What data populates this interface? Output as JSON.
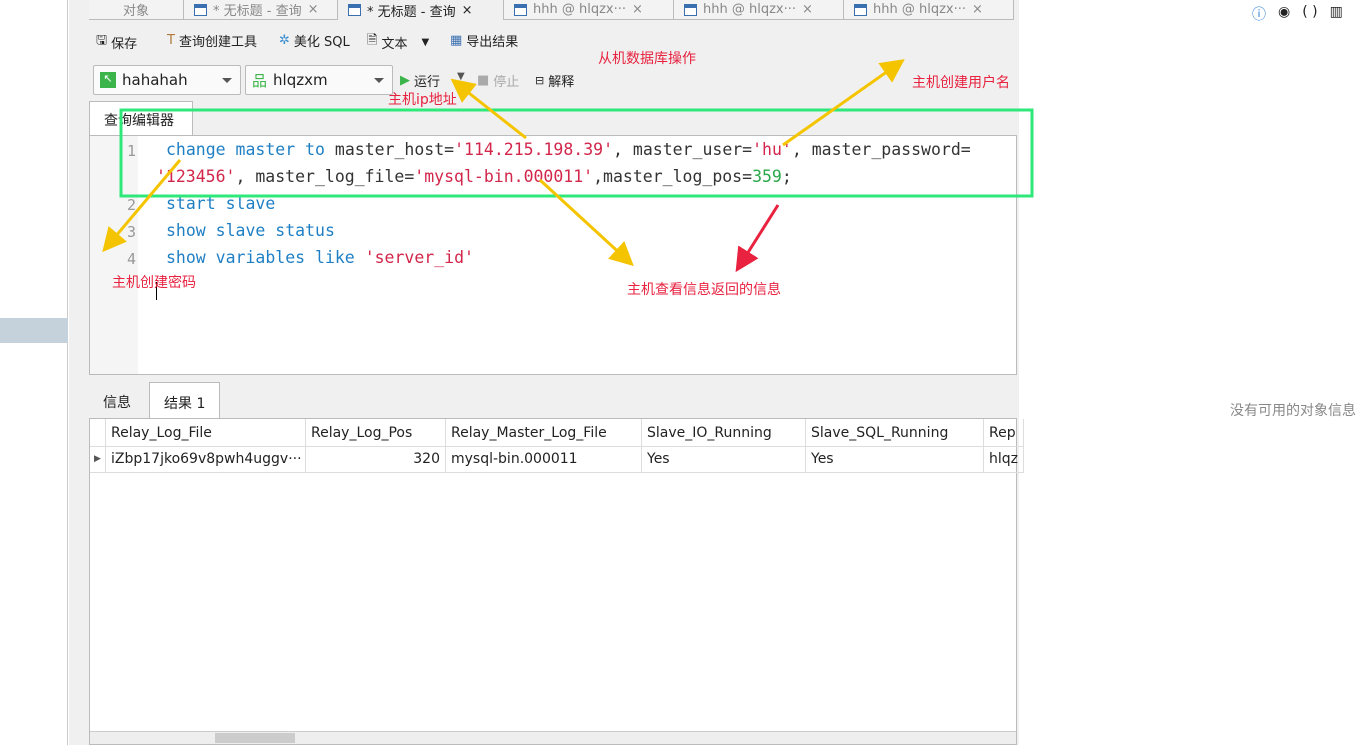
{
  "tabs": [
    {
      "label": "对象"
    },
    {
      "label": "* 无标题 - 查询"
    },
    {
      "label": "* 无标题 - 查询"
    },
    {
      "label": "hhh @ hlqzx···"
    },
    {
      "label": "hhh @ hlqzx···"
    },
    {
      "label": "hhh @ hlqzx···"
    }
  ],
  "toolbar": {
    "save": "保存",
    "query_builder": "查询创建工具",
    "beautify": "美化 SQL",
    "text": "文本",
    "export": "导出结果",
    "run": "运行",
    "stop": "停止",
    "explain": "解释"
  },
  "connection": "hahahah",
  "database": "hlqzxm",
  "editor_tab": "查询编辑器",
  "code": {
    "l1a": "change master to",
    "l1b": " master_host=",
    "host": "'114.215.198.39'",
    "l1c": ", master_user=",
    "user": "'hu'",
    "l1d": ", master_password=",
    "pwd": "'123456'",
    "l1e": ", master_log_file=",
    "file": "'mysql-bin.000011'",
    "l1f": ",master_log_pos=",
    "pos": "359",
    "l1g": ";",
    "l2": "start slave",
    "l3": "show slave status",
    "l4a": "show variables like",
    "l4b": "'server_id'"
  },
  "line_numbers": [
    "1",
    "2",
    "3",
    "4"
  ],
  "annotations": {
    "slave_ops": "从机数据库操作",
    "host_ip": "主机ip地址",
    "host_user": "主机创建用户名",
    "host_pwd": "主机创建密码",
    "info_returned": "主机查看信息返回的信息"
  },
  "result_tabs": [
    "信息",
    "结果 1"
  ],
  "columns": [
    "Relay_Log_File",
    "Relay_Log_Pos",
    "Relay_Master_Log_File",
    "Slave_IO_Running",
    "Slave_SQL_Running",
    "Rep"
  ],
  "rows": [
    [
      "iZbp17jko69v8pwh4uggv···",
      "320",
      "mysql-bin.000011",
      "Yes",
      "Yes",
      "hlqz"
    ]
  ],
  "right_panel": {
    "empty": "没有可用的对象信息"
  },
  "colors": {
    "highlight_box": "#2ee87a",
    "annotation": "#e8223f",
    "arrow_yellow": "#f5c400",
    "arrow_red": "#e8223f"
  }
}
